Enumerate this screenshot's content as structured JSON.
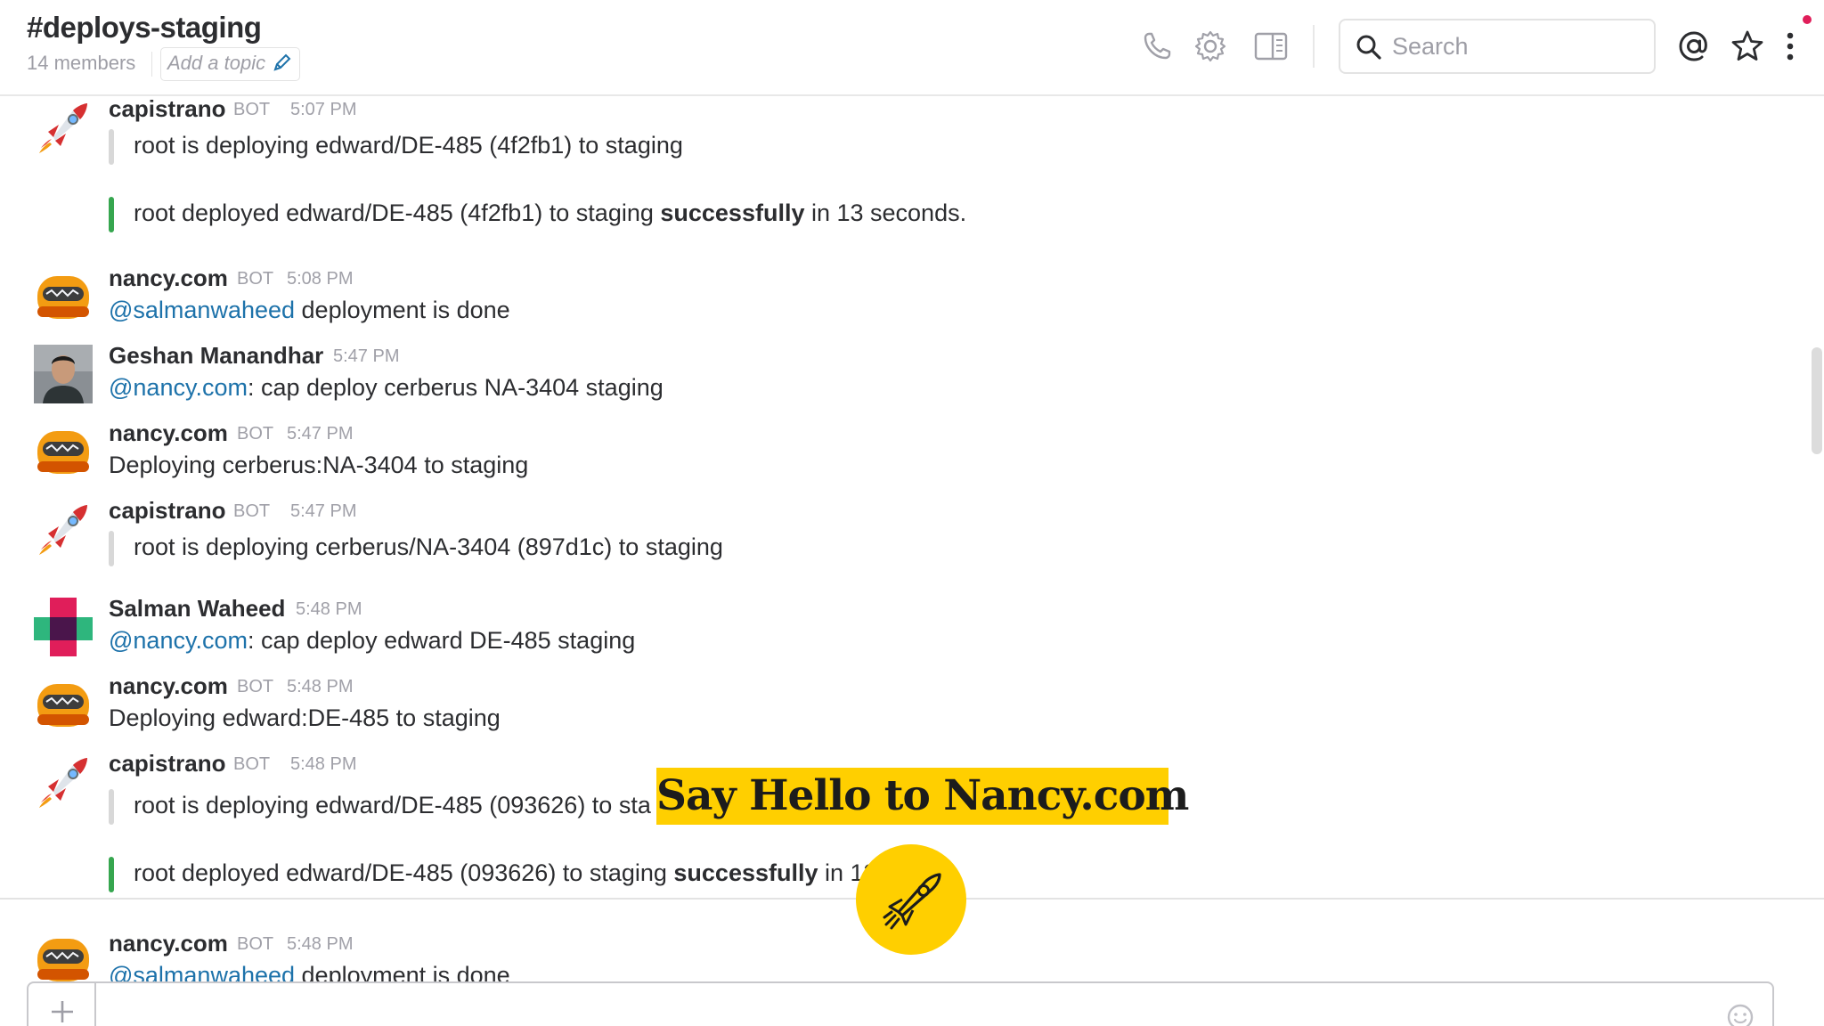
{
  "header": {
    "channel": "#deploys-staging",
    "members": "14 members",
    "topic_placeholder": "Add a topic",
    "search_placeholder": "Search"
  },
  "messages": [
    {
      "author": "capistrano",
      "bot": "BOT",
      "time": "5:07 PM",
      "avatar": "rocket-icon",
      "attachments": [
        {
          "text": "root is deploying edward/DE-485 (4f2fb1) to staging",
          "status": "pending"
        },
        {
          "pre": "root deployed edward/DE-485 (4f2fb1) to staging ",
          "strong": "successfully",
          "post": " in 13 seconds.",
          "status": "success"
        }
      ]
    },
    {
      "author": "nancy.com",
      "bot": "BOT",
      "time": "5:08 PM",
      "avatar": "robot-icon",
      "mention": "@salmanwaheed",
      "text": " deployment is done"
    },
    {
      "author": "Geshan Manandhar",
      "time": "5:47 PM",
      "avatar": "user-photo",
      "mention": "@nancy.com",
      "text": ": cap deploy cerberus NA-3404 staging"
    },
    {
      "author": "nancy.com",
      "bot": "BOT",
      "time": "5:47 PM",
      "avatar": "robot-icon",
      "text": "Deploying cerberus:NA-3404 to staging"
    },
    {
      "author": "capistrano",
      "bot": "BOT",
      "time": "5:47 PM",
      "avatar": "rocket-icon",
      "attachments": [
        {
          "text": "root is deploying cerberus/NA-3404 (897d1c) to staging",
          "status": "pending"
        }
      ]
    },
    {
      "author": "Salman Waheed",
      "time": "5:48 PM",
      "avatar": "identicon",
      "mention": "@nancy.com",
      "text": ": cap deploy edward DE-485 staging"
    },
    {
      "author": "nancy.com",
      "bot": "BOT",
      "time": "5:48 PM",
      "avatar": "robot-icon",
      "text": "Deploying edward:DE-485 to staging"
    },
    {
      "author": "capistrano",
      "bot": "BOT",
      "time": "5:48 PM",
      "avatar": "rocket-icon",
      "attachments": [
        {
          "text": "root is deploying edward/DE-485 (093626) to sta",
          "status": "pending"
        },
        {
          "pre": "root deployed edward/DE-485 (093626) to staging ",
          "strong": "successfully",
          "post": " in 13",
          "status": "success"
        }
      ]
    },
    {
      "author": "nancy.com",
      "bot": "BOT",
      "time": "5:48 PM",
      "avatar": "robot-icon",
      "mention": "@salmanwaheed",
      "text": " deployment is done"
    }
  ],
  "overlay": {
    "banner": "Say Hello to Nancy.com",
    "accent": "#ffcf00"
  },
  "colors": {
    "link": "#1d72aa",
    "success": "#36a64f",
    "muted": "#9e9ea6"
  }
}
